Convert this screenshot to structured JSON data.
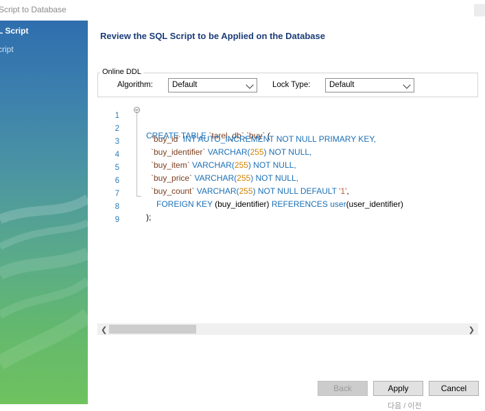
{
  "window": {
    "title": "Script to Database"
  },
  "sidebar": {
    "steps": [
      {
        "label": "L Script",
        "active": true
      },
      {
        "label": "cript",
        "active": false
      }
    ]
  },
  "main": {
    "title": "Review the SQL Script to be Applied on the Database",
    "online_ddl": {
      "legend": "Online DDL",
      "algorithm_label": "Algorithm:",
      "algorithm_value": "Default",
      "lock_type_label": "Lock Type:",
      "lock_type_value": "Default"
    },
    "line_numbers": [
      "1",
      "2",
      "3",
      "4",
      "5",
      "6",
      "7",
      "8",
      "9"
    ],
    "code": {
      "l1": {
        "a": "CREATE TABLE ",
        "b": "`tarel_db`",
        "c": ".",
        "d": "`buy`",
        "e": " ("
      },
      "l2": {
        "a": "`buy_id`",
        "b": " INT AUTO_INCREMENT NOT NULL PRIMARY KEY,"
      },
      "l3": {
        "a": "`buy_identifier`",
        "b": " VARCHAR(",
        "c": "255",
        "d": ") NOT NULL,"
      },
      "l4": {
        "a": "`buy_item`",
        "b": " VARCHAR(",
        "c": "255",
        "d": ") NOT NULL,"
      },
      "l5": {
        "a": "`buy_price`",
        "b": " VARCHAR(",
        "c": "255",
        "d": ") NOT NULL,"
      },
      "l6": {
        "a": "`buy_count`",
        "b": " VARCHAR(",
        "c": "255",
        "d": ") NOT NULL DEFAULT ",
        "e": "'1'",
        "f": ","
      },
      "l7": {
        "a": "FOREIGN KEY ",
        "b": "(buy_identifier) ",
        "c": "REFERENCES ",
        "d": "user",
        "e": "(user_identifier)"
      },
      "l8": {
        "a": ");"
      }
    }
  },
  "buttons": {
    "back": "Back",
    "apply": "Apply",
    "cancel": "Cancel"
  },
  "footer_fragment": "다음 / 이전"
}
